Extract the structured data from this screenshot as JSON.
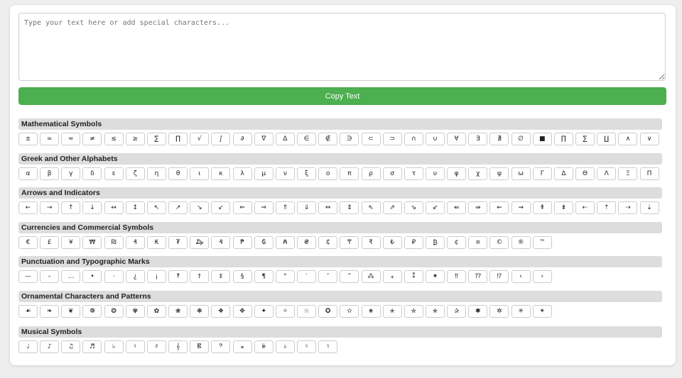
{
  "editor": {
    "placeholder": "Type your text here or add special characters...",
    "copy_label": "Copy Text"
  },
  "sections": [
    {
      "title": "Mathematical Symbols",
      "chars": [
        "±",
        "∞",
        "≈",
        "≠",
        "≤",
        "≥",
        "∑",
        "∏",
        "√",
        "∫",
        "∂",
        "∇",
        "∆",
        "∈",
        "∉",
        "∋",
        "⊂",
        "⊃",
        "∩",
        "∪",
        "∀",
        "∃",
        "∄",
        "∅",
        "■",
        "∏",
        "∑",
        "∐",
        "∧",
        "∨"
      ]
    },
    {
      "title": "Greek and Other Alphabets",
      "chars": [
        "α",
        "β",
        "γ",
        "δ",
        "ε",
        "ζ",
        "η",
        "θ",
        "ι",
        "κ",
        "λ",
        "μ",
        "ν",
        "ξ",
        "ο",
        "π",
        "ρ",
        "σ",
        "τ",
        "υ",
        "φ",
        "χ",
        "ψ",
        "ω",
        "Γ",
        "Δ",
        "Θ",
        "Λ",
        "Ξ",
        "Π"
      ]
    },
    {
      "title": "Arrows and Indicators",
      "chars": [
        "←",
        "→",
        "↑",
        "↓",
        "↔",
        "↕",
        "↖",
        "↗",
        "↘",
        "↙",
        "⇐",
        "⇒",
        "⇑",
        "⇓",
        "⇔",
        "⇕",
        "⇖",
        "⇗",
        "⇘",
        "⇙",
        "⇚",
        "⇛",
        "⇜",
        "⇝",
        "⇞",
        "⇟",
        "⇠",
        "⇡",
        "⇢",
        "⇣"
      ]
    },
    {
      "title": "Currencies and Commercial Symbols",
      "chars": [
        "€",
        "£",
        "¥",
        "₩",
        "₪",
        "₰",
        "₭",
        "₮",
        "₯",
        "₰",
        "₱",
        "₲",
        "₳",
        "₴",
        "₵",
        "₸",
        "₹",
        "₺",
        "₽",
        "₿",
        "¢",
        "¤",
        "©",
        "®",
        "™"
      ]
    },
    {
      "title": "Punctuation and Typographic Marks",
      "chars": [
        "—",
        "–",
        "…",
        "•",
        "·",
        "¿",
        "¡",
        "‽",
        "†",
        "‡",
        "§",
        "¶",
        "°",
        "′",
        "″",
        "‴",
        "⁂",
        "⁎",
        "⁑",
        "⁕",
        "‼",
        "⁇",
        "⁉",
        "‹",
        "›"
      ]
    },
    {
      "title": "Ornamental Characters and Patterns",
      "chars": [
        "☙",
        "❧",
        "❦",
        "❁",
        "❂",
        "✾",
        "✿",
        "❀",
        "❃",
        "❖",
        "✥",
        "✦",
        "✧",
        "☆",
        "✪",
        "✫",
        "✬",
        "✭",
        "✮",
        "✯",
        "✰",
        "✱",
        "✲",
        "✳",
        "✴"
      ]
    },
    {
      "title": "Musical Symbols",
      "chars": [
        "♩",
        "♪",
        "♫",
        "♬",
        "♭",
        "♮",
        "♯",
        "𝄞",
        "𝄡",
        "𝄢",
        "𝄪",
        "𝄫",
        "♭",
        "♮",
        "♮"
      ]
    }
  ]
}
